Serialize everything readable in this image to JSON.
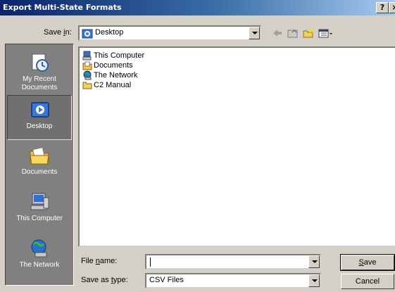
{
  "window": {
    "title": "Export Multi-State Formats",
    "help_label": "?",
    "close_label": "×"
  },
  "save_in": {
    "label_pre": "Save ",
    "label_u": "i",
    "label_post": "n:",
    "value": "Desktop",
    "icons": [
      "back-arrow-icon",
      "up-folder-icon",
      "new-folder-icon",
      "view-menu-icon"
    ]
  },
  "places": [
    {
      "label": "My Recent Documents",
      "icon": "recent-documents-icon",
      "selected": false
    },
    {
      "label": "Desktop",
      "icon": "desktop-icon",
      "selected": true
    },
    {
      "label": "Documents",
      "icon": "documents-icon",
      "selected": false
    },
    {
      "label": "This Computer",
      "icon": "computer-icon",
      "selected": false
    },
    {
      "label": "The Network",
      "icon": "network-icon",
      "selected": false
    }
  ],
  "files": [
    {
      "name": "This Computer",
      "icon": "computer-icon"
    },
    {
      "name": "Documents",
      "icon": "documents-folder-icon"
    },
    {
      "name": "The Network",
      "icon": "network-icon"
    },
    {
      "name": "C2 Manual",
      "icon": "folder-icon"
    }
  ],
  "filename": {
    "label_pre": "File ",
    "label_u": "n",
    "label_post": "ame:",
    "value": ""
  },
  "filetype": {
    "label_pre": "Save as ",
    "label_u": "t",
    "label_post": "ype:",
    "value": "CSV Files"
  },
  "buttons": {
    "save_u": "S",
    "save_rest": "ave",
    "cancel": "Cancel"
  },
  "colors": {
    "titlebar_start": "#0a246a",
    "titlebar_end": "#a6caf0",
    "face": "#d4d0c8",
    "places_bg": "#808080"
  }
}
